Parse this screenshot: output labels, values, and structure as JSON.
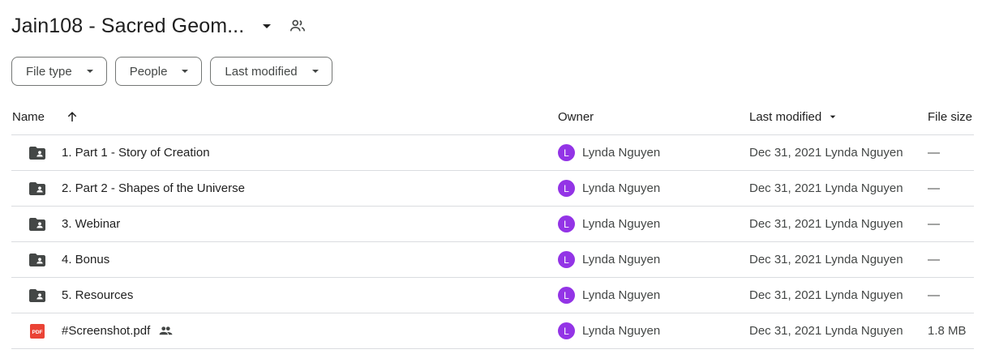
{
  "header": {
    "title": "Jain108 - Sacred Geom...",
    "caret_icon": "arrow-drop-down-icon",
    "shared_icon": "people-outline-icon"
  },
  "filters": [
    {
      "label": "File type",
      "icon": "arrow-drop-down-icon"
    },
    {
      "label": "People",
      "icon": "arrow-drop-down-icon"
    },
    {
      "label": "Last modified",
      "icon": "arrow-drop-down-icon"
    }
  ],
  "columns": {
    "name": "Name",
    "sort_icon": "arrow-up-icon",
    "owner": "Owner",
    "last_modified": "Last modified",
    "last_modified_icon": "arrow-drop-down-icon",
    "file_size": "File size"
  },
  "rows": [
    {
      "name": "1. Part 1 - Story of Creation",
      "type": "folder",
      "owner": "Lynda Nguyen",
      "owner_initial": "L",
      "modified": "Dec 31, 2021 Lynda Nguyen",
      "size": "—"
    },
    {
      "name": "2. Part 2 - Shapes of the Universe",
      "type": "folder",
      "owner": "Lynda Nguyen",
      "owner_initial": "L",
      "modified": "Dec 31, 2021 Lynda Nguyen",
      "size": "—"
    },
    {
      "name": "3. Webinar",
      "type": "folder",
      "owner": "Lynda Nguyen",
      "owner_initial": "L",
      "modified": "Dec 31, 2021 Lynda Nguyen",
      "size": "—"
    },
    {
      "name": "4. Bonus",
      "type": "folder",
      "owner": "Lynda Nguyen",
      "owner_initial": "L",
      "modified": "Dec 31, 2021 Lynda Nguyen",
      "size": "—"
    },
    {
      "name": "5. Resources",
      "type": "folder",
      "owner": "Lynda Nguyen",
      "owner_initial": "L",
      "modified": "Dec 31, 2021 Lynda Nguyen",
      "size": "—"
    },
    {
      "name": "#Screenshot.pdf",
      "type": "pdf",
      "shared": true,
      "owner": "Lynda Nguyen",
      "owner_initial": "L",
      "modified": "Dec 31, 2021 Lynda Nguyen",
      "size": "1.8 MB"
    }
  ],
  "colors": {
    "avatar": "#9334e6",
    "folder": "#444746",
    "pdf": "#ea4335",
    "divider": "#dadce0"
  }
}
